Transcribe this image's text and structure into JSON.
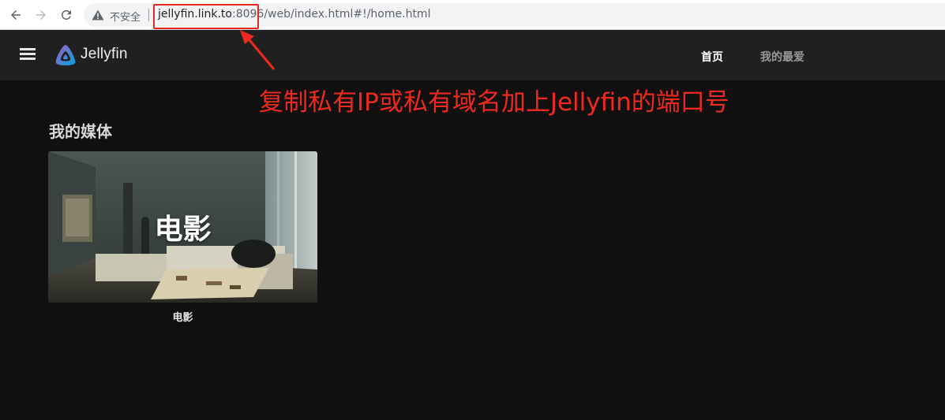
{
  "browser": {
    "security_label": "不安全",
    "url_host": "jellyfin.link.to",
    "url_port": ":8096",
    "url_path": "/web/index.html#!/home.html"
  },
  "header": {
    "logo_text": "Jellyfin",
    "tabs": [
      {
        "label": "首页",
        "active": true
      },
      {
        "label": "我的最爱",
        "active": false
      }
    ]
  },
  "annotation": {
    "text": "复制私有IP或私有域名加上Jellyfin的端口号",
    "color": "#ee2a1f"
  },
  "main": {
    "section_title": "我的媒体",
    "libraries": [
      {
        "overlay_title": "电影",
        "caption": "电影"
      }
    ]
  },
  "colors": {
    "background": "#101010",
    "header": "#202020",
    "logo_gradient_start": "#aa5cc3",
    "logo_gradient_end": "#00a4dc"
  }
}
